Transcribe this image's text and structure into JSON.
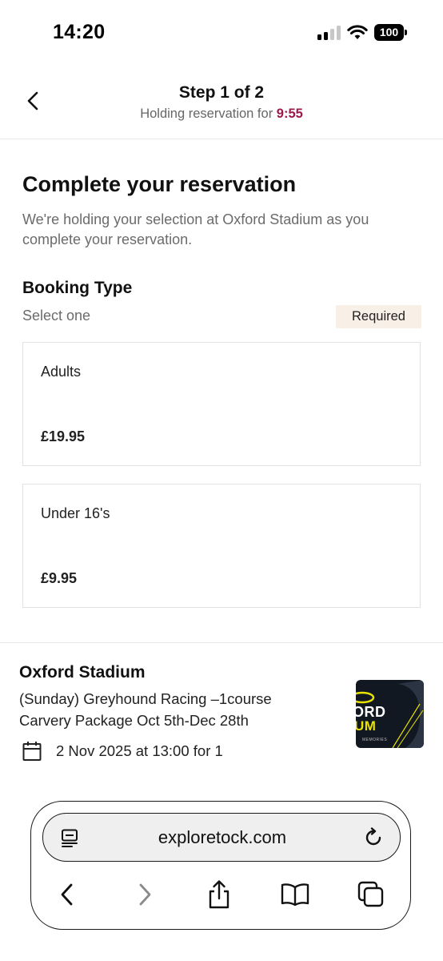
{
  "status_bar": {
    "time": "14:20",
    "battery": "100",
    "signal_icon": "cellular-signal-icon",
    "wifi_icon": "wifi-icon"
  },
  "header": {
    "step": "Step 1 of 2",
    "holding_prefix": "Holding reservation for ",
    "timer": "9:55",
    "back_icon": "chevron-left-icon",
    "timer_color": "#9b1a4b"
  },
  "main": {
    "title": "Complete your reservation",
    "description": "We're holding your selection at Oxford Stadium as you complete your reservation."
  },
  "booking_type": {
    "title": "Booking Type",
    "hint": "Select one",
    "required_label": "Required",
    "required_bg": "#f8efe6",
    "options": [
      {
        "name": "Adults",
        "price": "£19.95"
      },
      {
        "name": "Under 16's",
        "price": "£9.95"
      }
    ]
  },
  "summary": {
    "venue": "Oxford Stadium",
    "event": "(Sunday) Greyhound Racing –1course Carvery Package Oct 5th-Dec 28th",
    "date": "2 Nov 2025 at 13:00 for 1",
    "calendar_icon": "calendar-icon",
    "thumbnail": {
      "line1": "ORD",
      "line2": "UM",
      "line3": "MEMORIES"
    }
  },
  "browser": {
    "url": "exploretock.com",
    "reader_icon": "reader-mode-icon",
    "reload_icon": "reload-icon",
    "nav_icons": [
      "back-arrow-icon",
      "forward-arrow-icon",
      "share-icon",
      "bookmarks-icon",
      "tabs-icon"
    ]
  }
}
